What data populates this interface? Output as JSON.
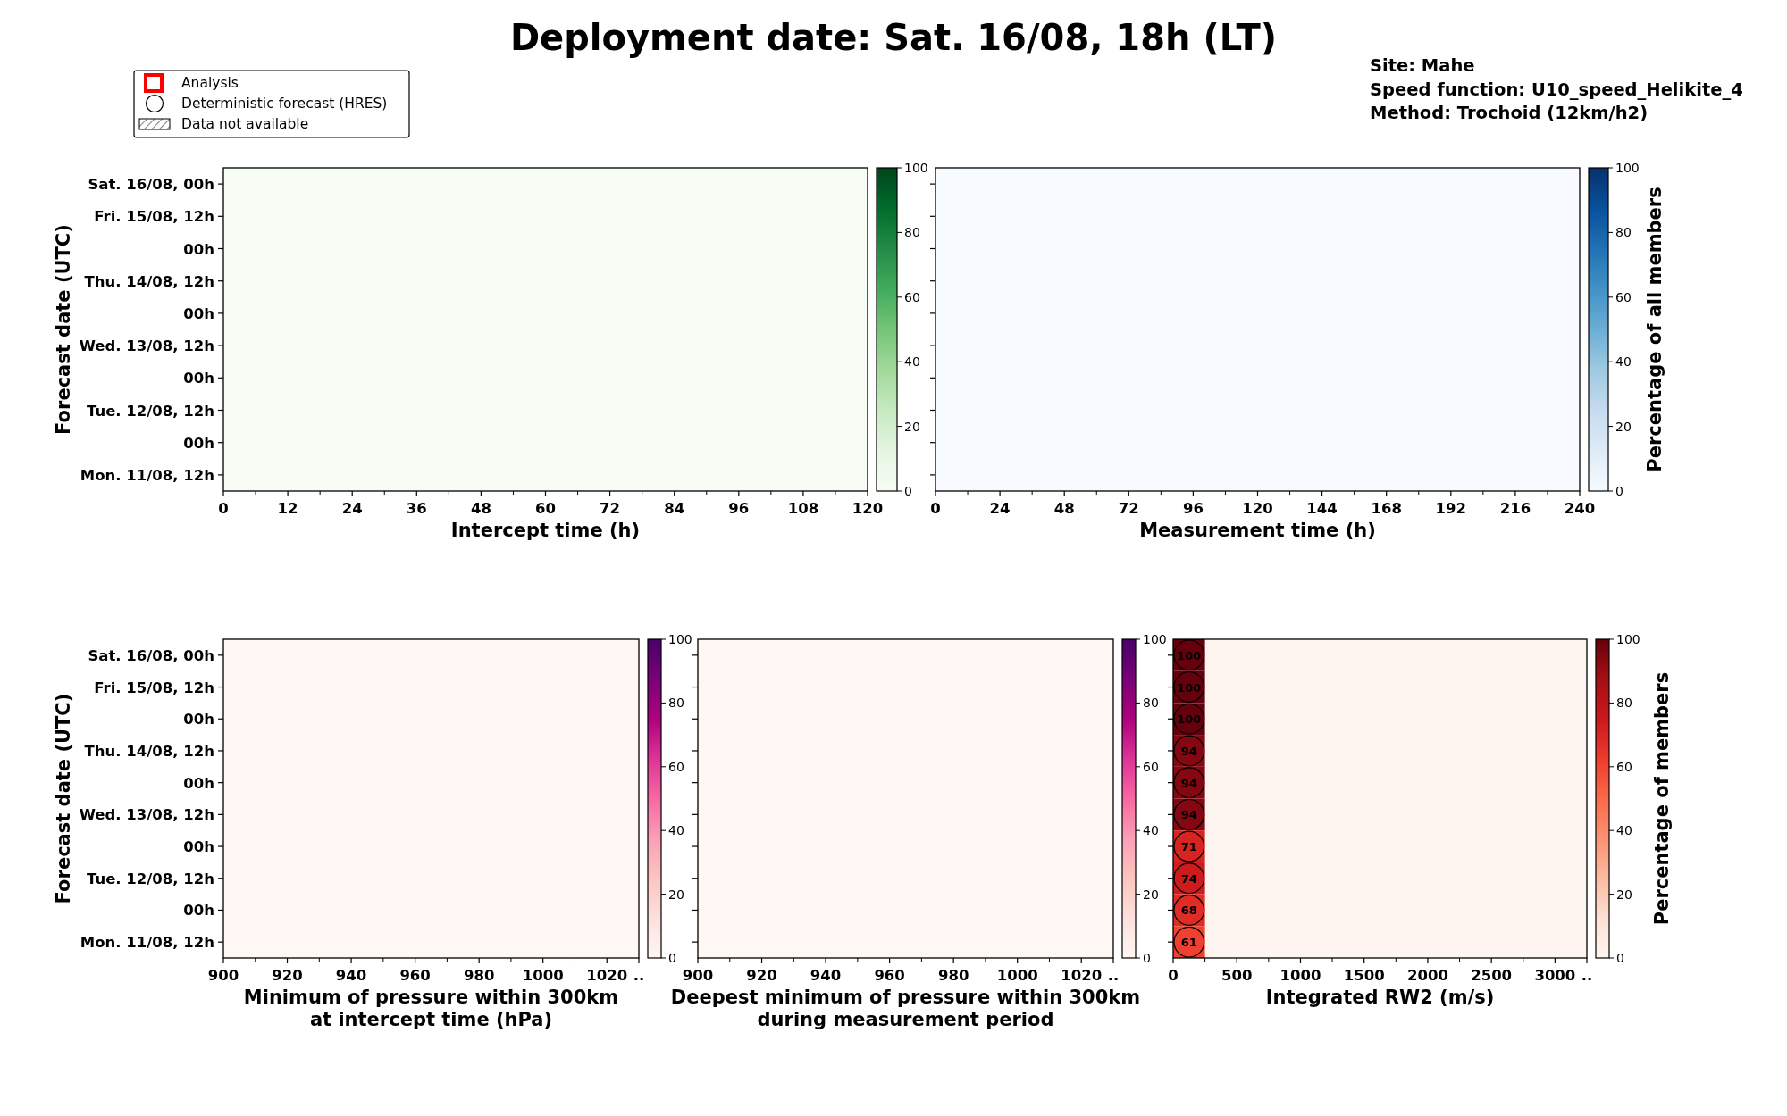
{
  "title": "Deployment date: Sat. 16/08, 18h (LT)",
  "legend": [
    {
      "kind": "analysis",
      "label": "Analysis"
    },
    {
      "kind": "deterministic",
      "label": "Deterministic forecast (HRES)"
    },
    {
      "kind": "unavailable",
      "label": "Data not available"
    }
  ],
  "info": [
    "Site: Mahe",
    "Speed function: U10_speed_Helikite_4",
    "Method: Trochoid (12km/h2)"
  ],
  "panels": [
    {
      "kind": "greens",
      "y_label": "Forecast date (UTC)",
      "y_ticks": [
        "Sat. 16/08, 00h",
        "Fri. 15/08, 12h",
        "00h",
        "Thu. 14/08, 12h",
        "00h",
        "Wed. 13/08, 12h",
        "00h",
        "Tue. 12/08, 12h",
        "00h",
        "Mon. 11/08, 12h"
      ],
      "x_ticks": [
        "0",
        "12",
        "24",
        "36",
        "48",
        "60",
        "72",
        "84",
        "96",
        "108",
        "120"
      ],
      "x_label": [
        "Intercept time (h)"
      ],
      "colorbar_ticks": [
        "100",
        "80",
        "60",
        "40",
        "20",
        "0"
      ]
    },
    {
      "kind": "blues",
      "x_ticks": [
        "0",
        "24",
        "48",
        "72",
        "96",
        "120",
        "144",
        "168",
        "192",
        "216",
        "240"
      ],
      "x_label": [
        "Measurement time (h)"
      ],
      "colorbar_ticks": [
        "100",
        "80",
        "60",
        "40",
        "20",
        "0"
      ],
      "colorbar_label": "Percentage of all members"
    },
    {
      "kind": "purples",
      "y_label": "Forecast date (UTC)",
      "y_ticks": [
        "Sat. 16/08, 00h",
        "Fri. 15/08, 12h",
        "00h",
        "Thu. 14/08, 12h",
        "00h",
        "Wed. 13/08, 12h",
        "00h",
        "Tue. 12/08, 12h",
        "00h",
        "Mon. 11/08, 12h"
      ],
      "x_ticks": [
        "900",
        "920",
        "940",
        "960",
        "980",
        "1000",
        "1020",
        ".."
      ],
      "x_label": [
        "Minimum of pressure within 300km",
        "at intercept time (hPa)"
      ],
      "colorbar_ticks": [
        "100",
        "80",
        "60",
        "40",
        "20",
        "0"
      ]
    },
    {
      "kind": "purples",
      "x_ticks": [
        "900",
        "920",
        "940",
        "960",
        "980",
        "1000",
        "1020",
        ".."
      ],
      "x_label": [
        "Deepest minimum of pressure within 300km",
        "during measurement period"
      ],
      "colorbar_ticks": [
        "100",
        "80",
        "60",
        "40",
        "20",
        "0"
      ]
    },
    {
      "kind": "reds",
      "x_ticks": [
        "0",
        "500",
        "1000",
        "1500",
        "2000",
        "2500",
        "3000",
        ".."
      ],
      "x_label": [
        "Integrated RW2 (m/s)"
      ],
      "colorbar_ticks": [
        "100",
        "80",
        "60",
        "40",
        "20",
        "0"
      ],
      "colorbar_label": "Percentage of members",
      "cells": [
        {
          "value": "100",
          "color": "#67000d"
        },
        {
          "value": "100",
          "color": "#67000d"
        },
        {
          "value": "100",
          "color": "#67000d"
        },
        {
          "value": "94",
          "color": "#850711"
        },
        {
          "value": "94",
          "color": "#850711"
        },
        {
          "value": "94",
          "color": "#850711"
        },
        {
          "value": "71",
          "color": "#d72322"
        },
        {
          "value": "74",
          "color": "#ce1b1e"
        },
        {
          "value": "68",
          "color": "#df2c25"
        },
        {
          "value": "61",
          "color": "#f04130"
        }
      ]
    }
  ]
}
